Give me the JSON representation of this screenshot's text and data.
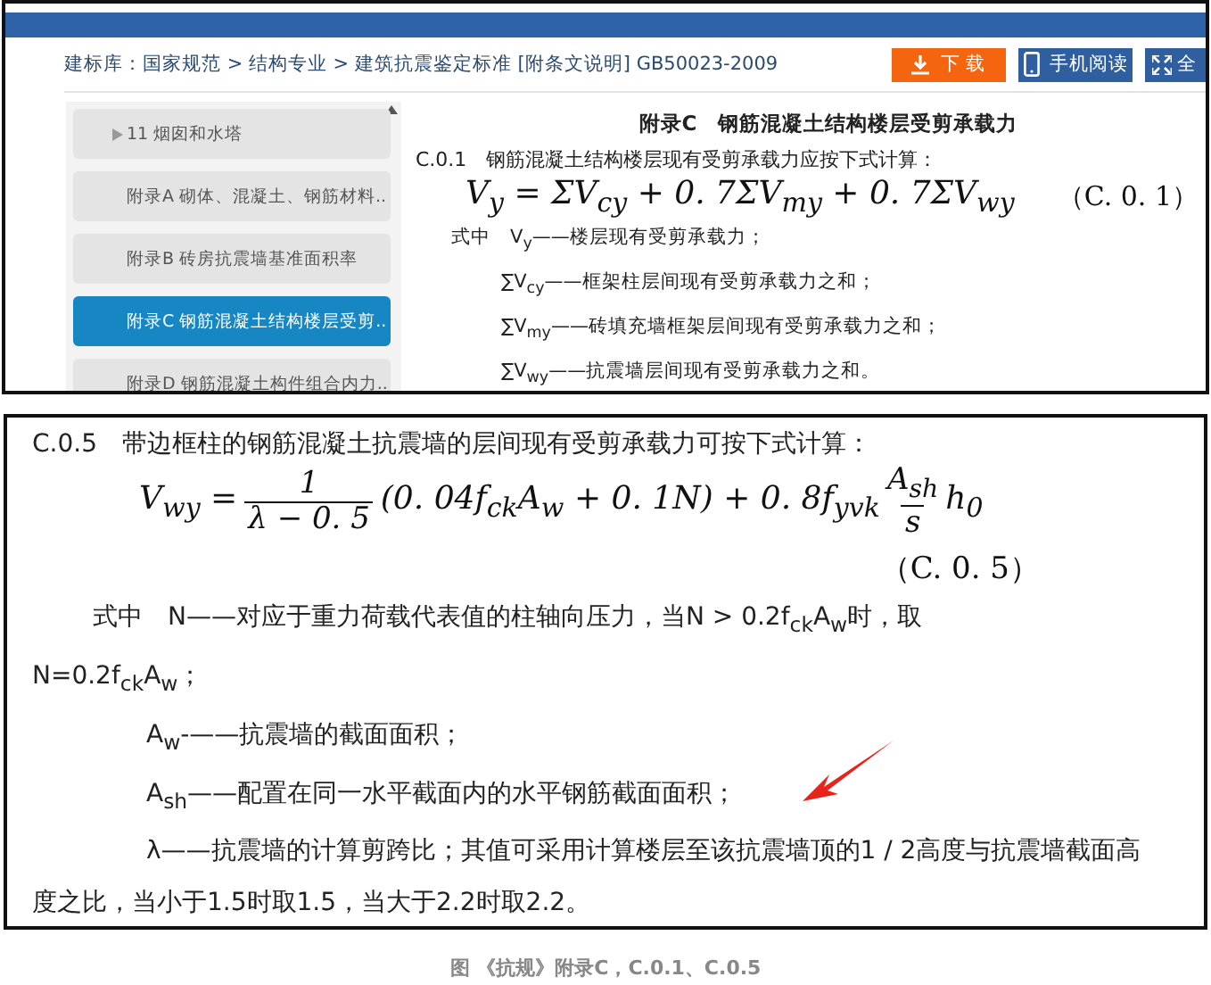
{
  "panel_top": {
    "breadcrumb": "建标库：国家规范 > 结构专业 > 建筑抗震鉴定标准 [附条文说明] GB50023-2009",
    "buttons": [
      {
        "label": "下 载",
        "kind": "download"
      },
      {
        "label": "手机阅读",
        "kind": "mobile"
      },
      {
        "label": "全",
        "kind": "fullscreen"
      }
    ],
    "sidebar": {
      "items": [
        {
          "label": "11 烟囱和水塔",
          "selected": false,
          "expandable": true
        },
        {
          "label": "附录A 砌体、混凝土、钢筋材料..",
          "selected": false,
          "expandable": false
        },
        {
          "label": "附录B 砖房抗震墙基准面积率",
          "selected": false,
          "expandable": false
        },
        {
          "label": "附录C 钢筋混凝土结构楼层受剪..",
          "selected": true,
          "expandable": false
        },
        {
          "label": "附录D 钢筋混凝土构件组合内力..",
          "selected": false,
          "expandable": false
        }
      ]
    },
    "content": {
      "title": "附录C　钢筋混凝土结构楼层受剪承载力",
      "clause": "C.0.1　钢筋混凝土结构楼层现有受剪承载力应按下式计算：",
      "formula": [
        {
          "kind": "text",
          "text": "V$_{y}$ = ΣV$_{cy}$ + 0. 7ΣV$_{my}$ + 0. 7ΣV$_{wy}$"
        }
      ],
      "formula_number": "（C. 0. 1）",
      "definitions": [
        {
          "kind": "lead",
          "text": "式中　V$_{y}$——楼层现有受剪承载力；"
        },
        {
          "kind": "item",
          "text": "∑V$_{cy}$——框架柱层间现有受剪承载力之和；"
        },
        {
          "kind": "item",
          "text": "∑V$_{my}$——砖填充墙框架层间现有受剪承载力之和；"
        },
        {
          "kind": "item",
          "text": "∑V$_{wy}$——抗震墙层间现有受剪承载力之和。"
        }
      ]
    }
  },
  "panel_bottom": {
    "clause": "C.0.5　带边框柱的钢筋混凝土抗震墙的层间现有受剪承载力可按下式计算：",
    "formula": [
      {
        "kind": "text",
        "text": "V$_{wy}$ ="
      },
      {
        "kind": "fraction",
        "numerator": "1",
        "denominator": "λ − 0. 5"
      },
      {
        "kind": "text",
        "text": "(0. 04f$_{ck}$A$_{w}$ + 0. 1N) + 0. 8f$_{yvk}$"
      },
      {
        "kind": "fraction",
        "numerator": "A$_{sh}$",
        "denominator": "s"
      },
      {
        "kind": "text",
        "text": "h$_{0}$"
      }
    ],
    "formula_number": "（C. 0. 5）",
    "paragraphs": [
      {
        "kind": "lead",
        "text": "式中　N——对应于重力荷载代表值的柱轴向压力，当N > 0.2f$_{ck}$A$_{w}$时，取N=0.2f$_{ck}$A$_{w}$；"
      },
      {
        "kind": "item",
        "text": "A$_{w}$-——抗震墙的截面面积；"
      },
      {
        "kind": "item",
        "text": "A$_{sh}$——配置在同一水平截面内的水平钢筋截面面积；"
      },
      {
        "kind": "item",
        "text": "λ——抗震墙的计算剪跨比；其值可采用计算楼层至该抗震墙顶的1 / 2高度与抗震墙截面高度之比，当小于1.5时取1.5，当大于2.2时取2.2。"
      }
    ]
  },
  "caption": "图 《抗规》附录C，C.0.1、C.0.5"
}
